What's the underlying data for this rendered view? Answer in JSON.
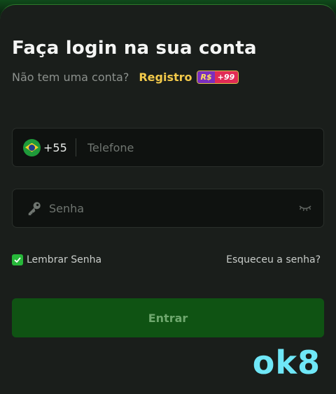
{
  "login": {
    "title": "Faça login na sua conta",
    "subtitle": "Não tem uma conta?",
    "register_label": "Registro",
    "bonus_currency": "R$",
    "bonus_amount": "+99"
  },
  "phone": {
    "country_code": "+55",
    "placeholder": "Telefone",
    "flag": "brazil-flag"
  },
  "password": {
    "placeholder": "Senha",
    "icons": [
      "key-icon",
      "eye-closed-icon"
    ]
  },
  "options": {
    "remember_label": "Lembrar Senha",
    "remember_checked": true,
    "forgot_label": "Esqueceu a senha?"
  },
  "submit_label": "Entrar",
  "watermark": "ok8",
  "colors": {
    "background": "#1a1e1b",
    "accent_green": "#0f5313",
    "register_yellow": "#f1c84a",
    "checkbox_green": "#27b83a",
    "watermark_cyan": "#6fe7f7"
  }
}
